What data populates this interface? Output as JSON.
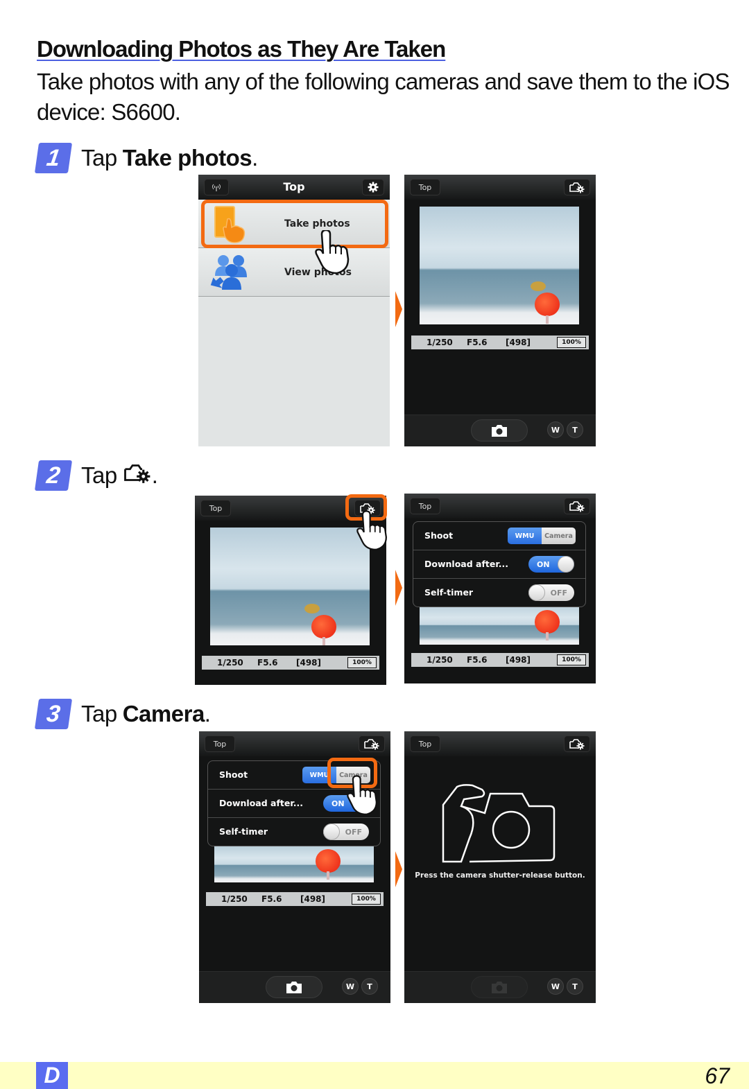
{
  "header": {
    "title": "Downloading Photos as They Are Taken",
    "intro": "Take photos with any of the following cameras and save them to the iOS device: S6600."
  },
  "steps": [
    {
      "number": "1",
      "prefix": "Tap",
      "target": "Take photos",
      "suffix": "."
    },
    {
      "number": "2",
      "prefix": "Tap",
      "target_icon": "camera-settings-icon",
      "suffix": "."
    },
    {
      "number": "3",
      "prefix": "Tap",
      "target": "Camera",
      "suffix": "."
    }
  ],
  "screens": {
    "top_menu": {
      "title": "Top",
      "left_icon": "wifi-antenna-icon",
      "right_icon": "gear-icon",
      "items": [
        {
          "label": "Take photos",
          "icon": "take-photos-icon",
          "highlighted": true
        },
        {
          "label": "View photos",
          "icon": "view-photos-icon",
          "highlighted": false
        }
      ]
    },
    "shooting": {
      "back_label": "Top",
      "settings_icon": "camera-settings-icon",
      "shutter_speed": "1/250",
      "aperture": "F5.6",
      "shots_remaining": "[498]",
      "battery": "100%",
      "shutter_button_icon": "camera-icon",
      "zoom_wide": "W",
      "zoom_tele": "T"
    },
    "settings_panel": {
      "rows": [
        {
          "label": "Shoot",
          "type": "segmented",
          "options": [
            "WMU",
            "Camera"
          ],
          "selected": "WMU"
        },
        {
          "label": "Download after...",
          "type": "toggle",
          "value": "ON"
        },
        {
          "label": "Self-timer",
          "type": "toggle",
          "value": "OFF"
        }
      ]
    },
    "camera_mode": {
      "back_label": "Top",
      "message": "Press the camera shutter-release button."
    }
  },
  "footer": {
    "section_tab": "D",
    "page_number": "67"
  },
  "colors": {
    "accent_orange": "#f36a12",
    "step_blue": "#5b6ee8",
    "footer_bg": "#ffffc4"
  }
}
